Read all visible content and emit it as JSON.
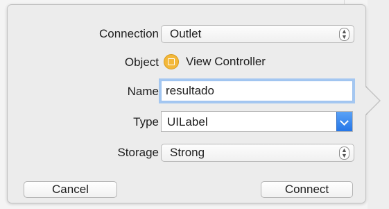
{
  "dialog": {
    "connection": {
      "label": "Connection",
      "value": "Outlet"
    },
    "object": {
      "label": "Object",
      "value": "View Controller",
      "icon": "view-controller-icon"
    },
    "name": {
      "label": "Name",
      "value": "resultado"
    },
    "type": {
      "label": "Type",
      "value": "UILabel"
    },
    "storage": {
      "label": "Storage",
      "value": "Strong"
    },
    "buttons": {
      "cancel": "Cancel",
      "connect": "Connect"
    }
  },
  "colors": {
    "accent": "#2576e7",
    "focus_ring": "#a4c7f1",
    "object_icon": "#f3b83a"
  }
}
